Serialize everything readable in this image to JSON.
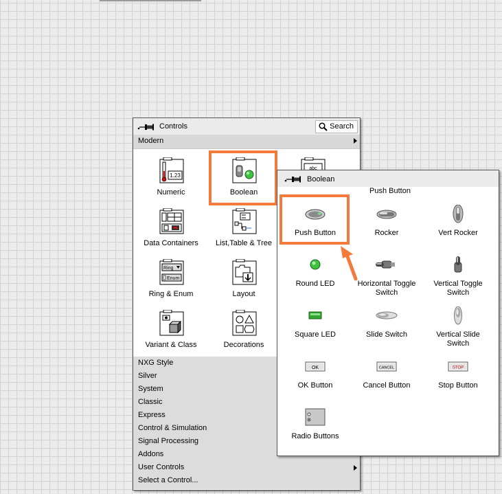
{
  "controls_palette": {
    "title": "Controls",
    "search_label": "Search",
    "category": "Modern",
    "grid": [
      {
        "label": "Numeric",
        "icon": "numeric-icon"
      },
      {
        "label": "Boolean",
        "icon": "boolean-icon"
      },
      {
        "label": "",
        "icon": "string-path-icon"
      },
      {
        "label": "Data Containers",
        "icon": "data-containers-icon"
      },
      {
        "label": "List,Table & Tree",
        "icon": "list-table-tree-icon"
      },
      {
        "label": "Ring & Enum",
        "icon": "ring-enum-icon"
      },
      {
        "label": "Layout",
        "icon": "layout-icon"
      },
      {
        "label": "Variant & Class",
        "icon": "variant-class-icon"
      },
      {
        "label": "Decorations",
        "icon": "decorations-icon"
      }
    ],
    "menu": [
      "NXG Style",
      "Silver",
      "System",
      "Classic",
      "Express",
      "Control & Simulation",
      "Signal Processing",
      "Addons",
      "User Controls",
      "Select a Control..."
    ],
    "icon_texts": {
      "numeric": "1.23",
      "ring": "Ring",
      "enum": "Enum",
      "string": "abc"
    }
  },
  "boolean_palette": {
    "title": "Boolean",
    "tooltip": "Push Button",
    "items": [
      {
        "label": "Push Button",
        "icon": "push-button-icon"
      },
      {
        "label": "Rocker",
        "icon": "rocker-icon"
      },
      {
        "label": "Vert Rocker",
        "icon": "vert-rocker-icon"
      },
      {
        "label": "Round LED",
        "icon": "round-led-icon"
      },
      {
        "label": "Horizontal Toggle Switch",
        "icon": "horizontal-toggle-icon"
      },
      {
        "label": "Vertical Toggle Switch",
        "icon": "vertical-toggle-icon"
      },
      {
        "label": "Square LED",
        "icon": "square-led-icon"
      },
      {
        "label": "Slide Switch",
        "icon": "slide-switch-icon"
      },
      {
        "label": "Vertical Slide Switch",
        "icon": "vertical-slide-icon"
      },
      {
        "label": "OK Button",
        "icon": "ok-button-icon"
      },
      {
        "label": "Cancel Button",
        "icon": "cancel-button-icon"
      },
      {
        "label": "Stop Button",
        "icon": "stop-button-icon"
      },
      {
        "label": "Radio Buttons",
        "icon": "radio-buttons-icon"
      }
    ],
    "button_texts": {
      "ok": "OK",
      "cancel": "CANCEL",
      "stop": "STOP"
    }
  },
  "colors": {
    "highlight": "#f47a3c",
    "led_green": "#3fc23f"
  }
}
